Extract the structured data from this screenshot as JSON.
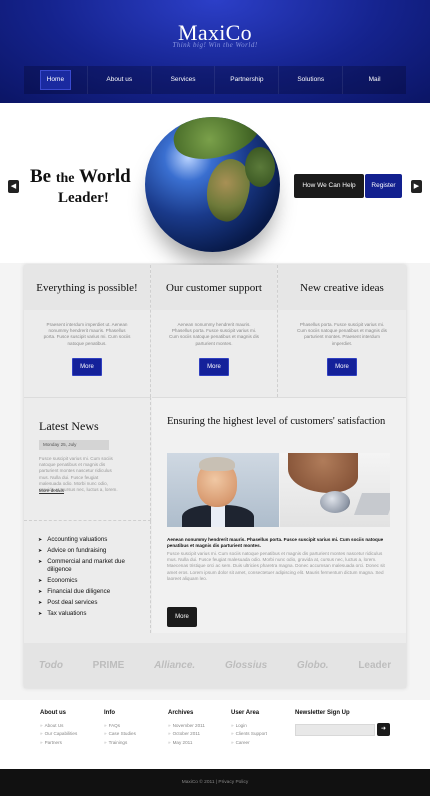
{
  "header": {
    "logo": "MaxiCo",
    "tagline": "Think big! Win the World!",
    "nav": [
      "Home",
      "About us",
      "Services",
      "Partnership",
      "Solutions",
      "Mail"
    ],
    "nav_active": 0
  },
  "hero": {
    "headline_be": "Be",
    "headline_the": "the",
    "headline_world": "World",
    "headline_leader": "Leader!",
    "help_button": "How We Can Help",
    "register_button": "Register",
    "prev_icon": "arrow-left-icon",
    "next_icon": "arrow-right-icon"
  },
  "features": [
    {
      "title": "Everything is possible!",
      "text": "Praesent interdum imperdiet ut. Aenean nonummy hendrerit mauris. Phasellus porta. Fusce suscipit varius mi. Cum sociis natoque penatibus.",
      "button": "More"
    },
    {
      "title": "Our customer support",
      "text": "Aenean nonummy hendrerit mauris. Phasellus porta. Fusce suscipit varius mi. Cum sociis natoque penatibus et magnis dis parturient montes.",
      "button": "More"
    },
    {
      "title": "New creative ideas",
      "text": "Phasellus porta. Fusce suscipit varius mi. Cum sociis natoque penatibus et magnis dis parturient montes. Praesent interdum imperdiet.",
      "button": "More"
    }
  ],
  "news": {
    "title": "Latest News",
    "date": "Monday 25, July",
    "text": "Fusce suscipit varius mi. Cum sociis natoque penatibus et magnis dis parturient montes nascetur ridiculus mus. Nulla dui. Fusce feugiat malesuada odio. Morbi nunc odio, gravida at, cursus nec, luctus a, lorem.",
    "more": "More details"
  },
  "services": [
    "Accounting valuations",
    "Advice on fundraising",
    "Commercial and market due diligence",
    "Economics",
    "Financial due diligence",
    "Post deal services",
    "Tax valuations"
  ],
  "article": {
    "title": "Ensuring the highest level of customers' satisfaction",
    "subtitle": "Aenean nonummy hendrerit mauris. Phasellus porta. Fusce suscipit varius mi. Cum sociis natoque penatibus et magnis dis parturient montes.",
    "body": "Fusce suscipit varius mi. Cum sociis natoque penatibus et magnis dis parturient montes nascetur ridiculus mus. Nulla dui. Fusce feugiat malesuada odio. Morbi nunc odio, gravida at, cursus nec, luctus a, lorem. Maecenas tristique orci ac sem. Duis ultricies pharetra magna. Donec accumsan malesuada orci. Donec sit amet eros. Lorem ipsum dolor sit amet, consectetuer adipiscing elit. Mauris fermentum dictum magna. Sed laoreet aliquam leo.",
    "button": "More"
  },
  "partners": [
    "Todo",
    "PRIME",
    "Alliance.",
    "Glossius",
    "Globo.",
    "Leader"
  ],
  "footer": {
    "about": {
      "title": "About us",
      "links": [
        "About Us",
        "Our Capabilities",
        "Partners"
      ]
    },
    "info": {
      "title": "Info",
      "links": [
        "FAQs",
        "Case Studies",
        "Trainings"
      ]
    },
    "archives": {
      "title": "Archives",
      "links": [
        "November 2011",
        "October 2011",
        "May 2011"
      ]
    },
    "user": {
      "title": "User Area",
      "links": [
        "Login",
        "Clients Support",
        "Career"
      ]
    },
    "newsletter": {
      "title": "Newsletter Sign Up",
      "input_value": "",
      "submit_icon": "arrow-right-icon"
    }
  },
  "copyright": "MaxiCo © 2011 | Privacy Policy",
  "colors": {
    "brand_blue": "#14219a",
    "header_dark": "#0b1565",
    "dark_button": "#1b1b1b"
  }
}
